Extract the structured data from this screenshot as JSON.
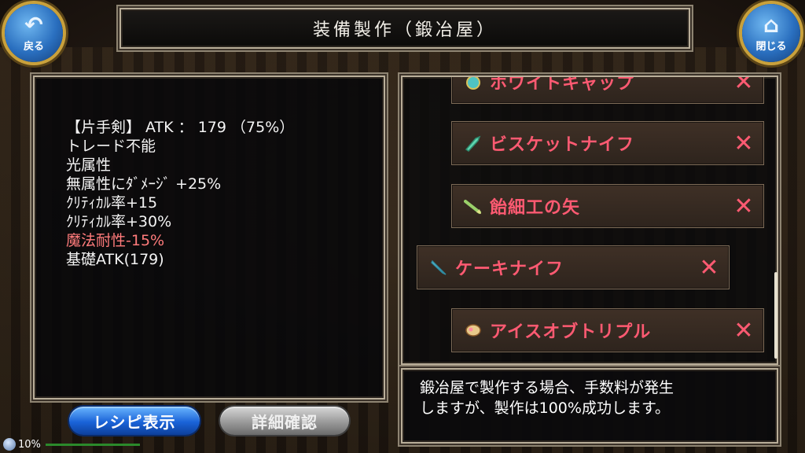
{
  "header": {
    "title": "装備製作（鍛冶屋）",
    "back_label": "戻る",
    "close_label": "閉じる",
    "back_icon": "back-arrow-icon",
    "close_icon": "home-icon"
  },
  "item_detail": {
    "lines": [
      {
        "text": "【片手剣】 ATK ： 179 （75%）",
        "negative": false
      },
      {
        "text": "トレード不能",
        "negative": false
      },
      {
        "text": "光属性",
        "negative": false
      },
      {
        "text": "無属性にﾀﾞﾒｰｼﾞ +25%",
        "negative": false
      },
      {
        "text": "ｸﾘﾃｨｶﾙ率+15",
        "negative": false
      },
      {
        "text": "ｸﾘﾃｨｶﾙ率+30%",
        "negative": false
      },
      {
        "text": "魔法耐性-15%",
        "negative": true
      },
      {
        "text": "基礎ATK(179)",
        "negative": false
      }
    ]
  },
  "recipes": [
    {
      "name": "ホワイトキャップ",
      "icon": "cap-icon",
      "mark": "✕",
      "selected": false
    },
    {
      "name": "ビスケットナイフ",
      "icon": "knife-icon",
      "mark": "✕",
      "selected": false
    },
    {
      "name": "飴細工の矢",
      "icon": "arrow-icon",
      "mark": "✕",
      "selected": false
    },
    {
      "name": "ケーキナイフ",
      "icon": "knife-icon",
      "mark": "✕",
      "selected": true
    },
    {
      "name": "アイスオブトリプル",
      "icon": "ice-cream-icon",
      "mark": "✕",
      "selected": false
    }
  ],
  "info": {
    "line1": "鍛冶屋で製作する場合、手数料が発生",
    "line2": "しますが、製作は100%成功します。"
  },
  "buttons": {
    "recipe_label": "レシピ表示",
    "detail_label": "詳細確認"
  },
  "status": {
    "percent": "10%"
  },
  "colors": {
    "recipe_text": "#ff5a72",
    "negative_stat": "#ff7b7b",
    "primary_button": "#1a63d8"
  }
}
